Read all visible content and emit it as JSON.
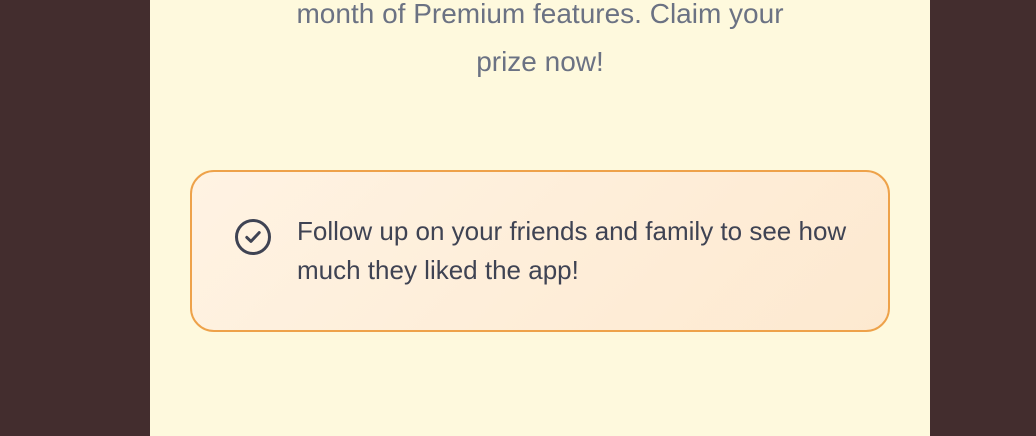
{
  "intro": {
    "line1": "month of Premium features. Claim your",
    "line2": "prize now!"
  },
  "callout": {
    "icon": "check-circle-icon",
    "message": "Follow up on your friends and family to see how much they liked the app!"
  },
  "colors": {
    "background": "#432d2e",
    "panel": "#fef9dd",
    "callout_border": "#eea24a",
    "callout_fill": "#fdecd6",
    "intro_text": "#6b7283",
    "message_text": "#3f4353"
  }
}
